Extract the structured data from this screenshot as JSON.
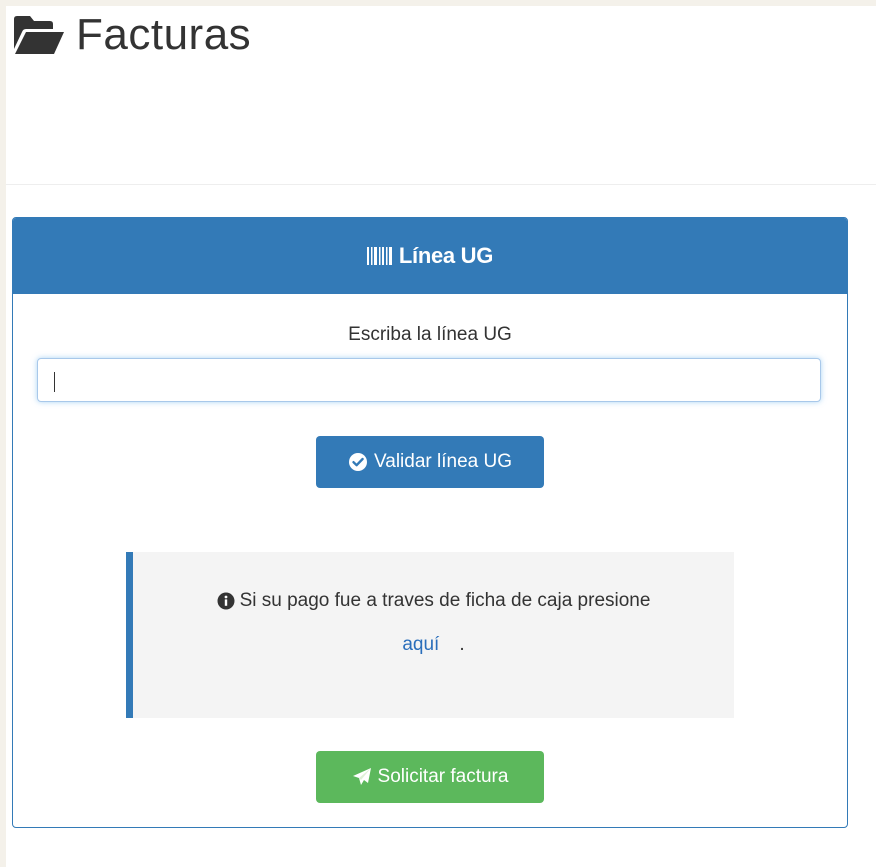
{
  "header": {
    "title": "Facturas",
    "icon": "folder-open-icon"
  },
  "panel": {
    "title": "Línea UG",
    "title_icon": "barcode-icon",
    "accent_color": "#337ab7",
    "form": {
      "label": "Escriba la línea UG",
      "input_value": "",
      "input_placeholder": ""
    },
    "validate_button": {
      "label": "Validar línea UG",
      "icon": "check-circle-icon"
    },
    "info_callout": {
      "icon": "info-circle-icon",
      "text": "Si su pago fue a traves de ficha de caja presione",
      "link_text": "aquí",
      "trailing": "."
    },
    "request_button": {
      "label": "Solicitar factura",
      "icon": "paper-plane-icon",
      "color": "#5cb85c"
    }
  }
}
